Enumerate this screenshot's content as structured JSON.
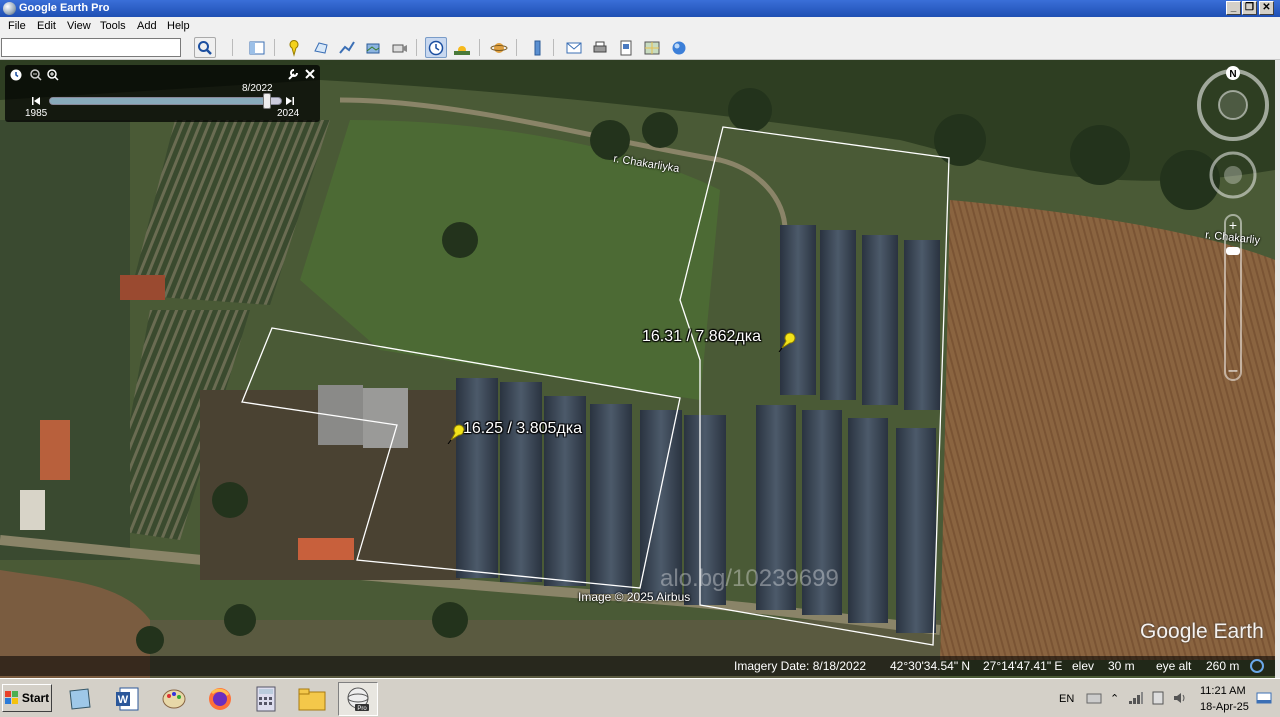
{
  "window": {
    "title": "Google Earth Pro",
    "controls": [
      "_",
      "❐",
      "✕"
    ]
  },
  "menu": [
    "File",
    "Edit",
    "View",
    "Tools",
    "Add",
    "Help"
  ],
  "search": {
    "value": "",
    "placeholder": ""
  },
  "toolbar": {
    "icons": [
      "search-icon",
      "sidebar-icon",
      "placemark-icon",
      "polygon-icon",
      "path-icon",
      "overlay-icon",
      "tour-icon",
      "historical-imagery-icon",
      "sun-icon",
      "planets-icon",
      "ruler-icon",
      "email-icon",
      "print-icon",
      "save-image-icon",
      "maps-icon",
      "earth-icon"
    ]
  },
  "time_slider": {
    "current": "8/2022",
    "start_year": "1985",
    "end_year": "2024",
    "position": 0.94
  },
  "map": {
    "placemarks": [
      {
        "label": "16.31 / 7.862дка"
      },
      {
        "label": "16.25 / 3.805дка"
      }
    ],
    "road_labels": [
      "r. Chakarliyka",
      "r. Chakarliy"
    ],
    "copyright": "Image © 2025 Airbus",
    "watermark": "alo.bg/10239699",
    "brand": "Google Earth",
    "compass": "N"
  },
  "status": {
    "imagery_date": "Imagery Date: 8/18/2022",
    "lat": "42°30'34.54\" N",
    "lon": "27°14'47.41\" E",
    "elev_label": "elev",
    "elev": "30 m",
    "eye_label": "eye alt",
    "eye": "260 m"
  },
  "taskbar": {
    "start": "Start",
    "language": "EN",
    "time": "11:21 AM",
    "date": "18-Apr-25"
  },
  "colors": {
    "titlebar": "#2458c6",
    "placemark": "#f2e31a",
    "outline": "#ffffff"
  }
}
